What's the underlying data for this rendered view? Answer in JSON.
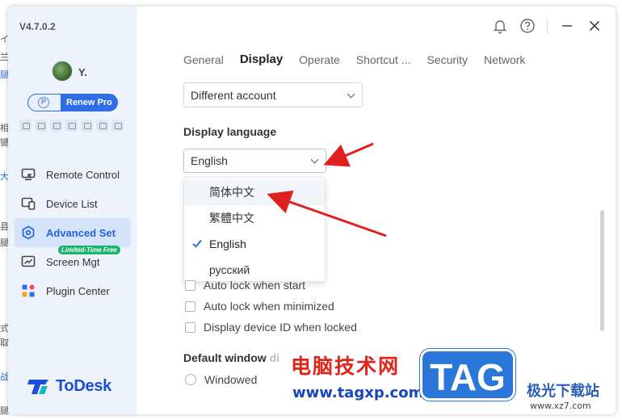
{
  "background_window": {
    "edge_fragments": [
      "イ",
      "兰",
      "腿",
      "相",
      "键",
      "大",
      "县",
      "腿",
      "式",
      "取",
      "战",
      "腿"
    ]
  },
  "app": {
    "version": "V4.7.0.2",
    "user": {
      "name": "Y."
    },
    "renew_label": "Renew Pro",
    "logo_text": "ToDesk",
    "accent_color": "#2e6de6"
  },
  "sidebar": {
    "items": [
      {
        "label": "Remote Control",
        "icon": "monitor-remote-icon"
      },
      {
        "label": "Device List",
        "icon": "device-list-icon"
      },
      {
        "label": "Advanced Set",
        "icon": "hexagon-settings-icon",
        "active": true
      },
      {
        "label": "Screen Mgt",
        "icon": "screen-chart-icon",
        "badge": "Limited-Time Free"
      },
      {
        "label": "Plugin Center",
        "icon": "plugin-grid-icon"
      }
    ]
  },
  "tabs": [
    "General",
    "Display",
    "Operate",
    "Shortcut ...",
    "Security",
    "Network"
  ],
  "active_tab": "Display",
  "settings": {
    "account_select_value": "Different account",
    "display_language_title": "Display language",
    "language_select_value": "English",
    "language_options": [
      "简体中文",
      "繁體中文",
      "English",
      "русский"
    ],
    "selected_language": "English",
    "checkboxes": [
      {
        "label": "Auto lock when start",
        "checked": false
      },
      {
        "label": "Auto lock when minimized",
        "checked": false
      },
      {
        "label": "Display device ID when locked",
        "checked": false
      }
    ],
    "default_window_title": "Default window",
    "default_window_title_tail": "di",
    "window_options": [
      "Windowed"
    ]
  },
  "watermark": {
    "cn_text": "电脑技术网",
    "url": "www.tagxp.com",
    "tag": "TAG",
    "site": "极光下载站",
    "site_url": "www.xz7.com"
  }
}
